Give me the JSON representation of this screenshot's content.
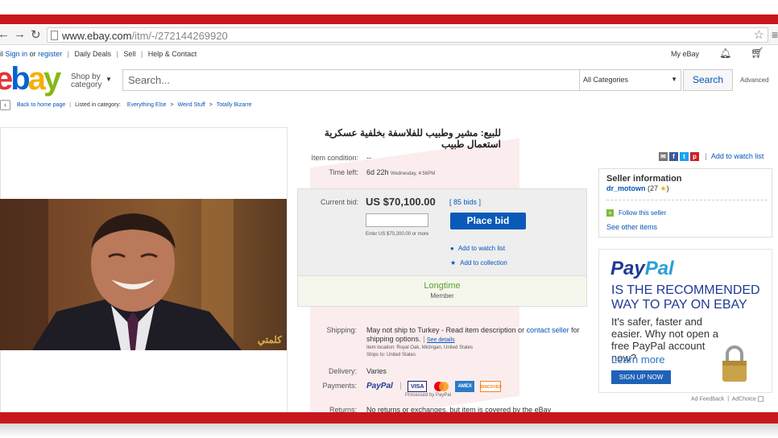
{
  "browser": {
    "url_host": "www.ebay.com",
    "url_path": "/itm/-/272144269920"
  },
  "toplinks": {
    "sign_in_prefix": "il",
    "sign_in": "Sign in",
    "or": "or",
    "register": "register",
    "daily_deals": "Daily Deals",
    "sell": "Sell",
    "help": "Help & Contact",
    "my_ebay": "My eBay"
  },
  "header": {
    "shop_by": "Shop by",
    "category": "category",
    "search_placeholder": "Search...",
    "categories": "All Categories",
    "search_button": "Search",
    "advanced": "Advanced"
  },
  "breadcrumb": {
    "back": "Back to home page",
    "listed": "Listed in category:",
    "path": [
      "Everything Else",
      "Weird Stuff",
      "Totally Bizarre"
    ]
  },
  "item": {
    "title": "للبيع: مشير وطبيب للفلاسفة بخلفية عسكرية استعمال طبيب",
    "condition_label": "Item condition:",
    "condition_value": "--",
    "time_left_label": "Time left:",
    "time_left_value": "6d 22h",
    "time_left_detail": "Wednesday, 4:56PM",
    "current_bid_label": "Current bid:",
    "current_bid_value": "US $70,100.00",
    "bids": "[ 85 bids ]",
    "enter_hint": "Enter US $70,200.00 or more",
    "place_bid": "Place bid",
    "add_watch": "Add to watch list",
    "add_collection": "Add to collection",
    "longtime": "Longtime",
    "member": "Member",
    "shipping_label": "Shipping:",
    "shipping_value": "May not ship to Turkey - Read item description or",
    "contact_seller": "contact seller",
    "shipping_value2": "for shipping options.",
    "see_details": "See details",
    "item_location": "Item location:  Royal Oak, Michigan, United States",
    "ships_to": "Ships to:  United States",
    "delivery_label": "Delivery:",
    "delivery_value": "Varies",
    "payments_label": "Payments:",
    "processed": "Processed by PayPal",
    "returns_label": "Returns:",
    "returns_value": "No returns or exchanges, but item is covered by the eBay"
  },
  "share": {
    "add_watch": "Add to watch list"
  },
  "seller": {
    "title": "Seller information",
    "name": "dr_motown",
    "score": "(27",
    "score_close": ")",
    "follow": "Follow this seller",
    "other_items": "See other items"
  },
  "paypal_ad": {
    "logo_a": "Pay",
    "logo_b": "Pal",
    "headline": "IS THE RECOMMENDED WAY TO PAY ON EBAY",
    "sub": "It's safer, faster and easier. Why not open a free PayPal account now?",
    "learn_more": "Learn more",
    "signup": "SIGN UP NOW",
    "ad_feedback": "Ad Feedback",
    "adchoice": "AdChoice"
  },
  "photo": {
    "watermark": "كلمتي"
  },
  "colors": {
    "frame_red": "#c8171c",
    "ebay_blue": "#0654ba",
    "bid_button": "#0a5ab8"
  }
}
